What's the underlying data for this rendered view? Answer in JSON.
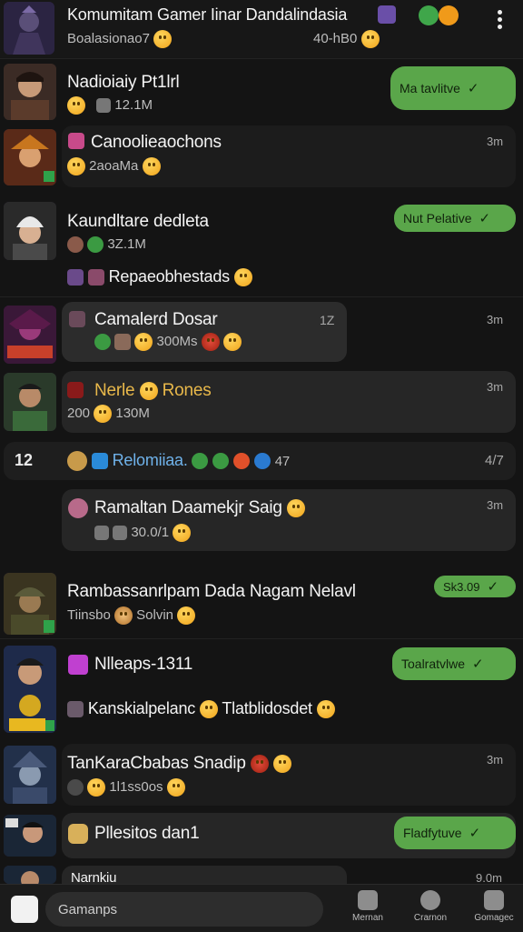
{
  "header": {
    "title": "Komumitam Gamer Iinar Dandalindasia",
    "subtitle": "Boalasionao7",
    "count": "40-hB0"
  },
  "chats": [
    {
      "title": "Nadioiaiy Pt1lrl",
      "sub": "12.1M"
    },
    {
      "title": "Canoolieaochons",
      "sub": "2aoaMa",
      "time": "3m"
    },
    {
      "title": "Kaundltare dedleta",
      "sub": "3Z.1M",
      "line3": "Repaeobhestads"
    },
    {
      "title": "Camalerd Dosar",
      "sub": "300Ms",
      "mid": "1Z",
      "time": "3m"
    },
    {
      "title": "Nerle",
      "title2": "Rones",
      "sub_pre": "200",
      "sub": "130M",
      "time": "3m"
    },
    {
      "num": "12",
      "title": "Relomiiaa.",
      "right_num": "47",
      "right2": "4/7"
    },
    {
      "title": "Ramaltan Daamekjr Saig",
      "sub": "30.0/1",
      "time": "3m"
    },
    {
      "title": "Rambassanrlpam Dada Nagam Nelavl",
      "sub_pre": "Tiinsbo",
      "sub": "Solvin"
    },
    {
      "title": "Nlleaps-1311",
      "line3": "Kanskialpelanc",
      "line3b": "Tlatblidosdet"
    },
    {
      "title": "TanKaraCbabas Snadip",
      "sub": "1l1ss0os",
      "time": "3m"
    },
    {
      "title": "Pllesitos dan1"
    },
    {
      "title": "Narnkiu",
      "time": "9.0m"
    }
  ],
  "pills": {
    "p1": "Ma tavlitve",
    "p2": "Nut Pelative",
    "p3": "Sk3.09",
    "p4": "Toalratvlwe",
    "p5": "Fladfytuve"
  },
  "footer": {
    "search_placeholder": "Gamanps",
    "nav": [
      "Mernan",
      "Crarnon",
      "Gomagec"
    ]
  },
  "colors": {
    "accent": "#5aa64a",
    "background": "#141414"
  }
}
